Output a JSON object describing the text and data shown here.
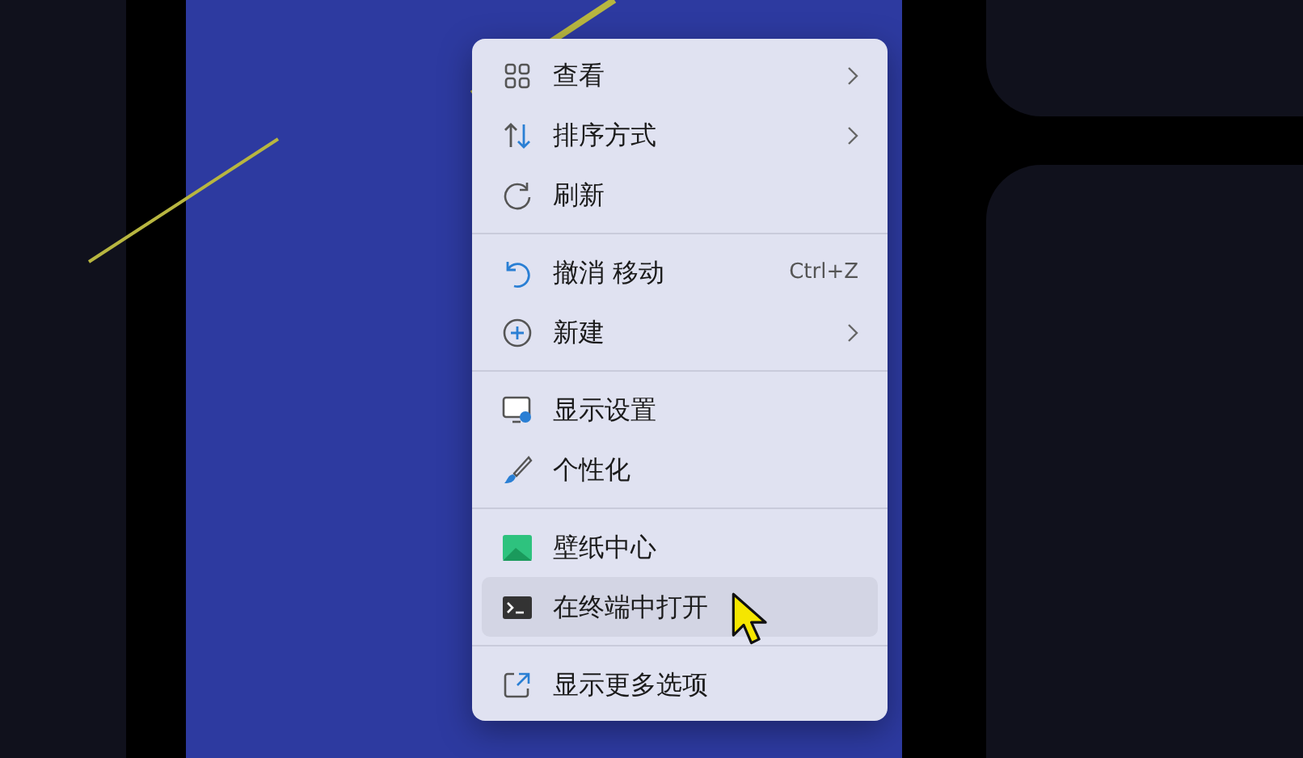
{
  "menu": [
    {
      "kind": "item",
      "label": "查看",
      "submenu": true,
      "selected": false
    },
    {
      "kind": "item",
      "label": "排序方式",
      "submenu": true,
      "selected": false
    },
    {
      "kind": "item",
      "label": "刷新",
      "submenu": false,
      "selected": false
    },
    {
      "kind": "separator"
    },
    {
      "kind": "item",
      "label": "撤消 移动",
      "shortcut": "Ctrl+Z",
      "submenu": false,
      "selected": false
    },
    {
      "kind": "item",
      "label": "新建",
      "submenu": true,
      "selected": false
    },
    {
      "kind": "separator"
    },
    {
      "kind": "item",
      "label": "显示设置",
      "submenu": false,
      "selected": false
    },
    {
      "kind": "item",
      "label": "个性化",
      "submenu": false,
      "selected": false
    },
    {
      "kind": "separator"
    },
    {
      "kind": "item",
      "label": "壁纸中心",
      "submenu": false,
      "selected": false
    },
    {
      "kind": "item",
      "label": "在终端中打开",
      "submenu": false,
      "selected": true
    },
    {
      "kind": "separator"
    },
    {
      "kind": "item",
      "label": "显示更多选项",
      "submenu": false,
      "selected": false
    }
  ]
}
